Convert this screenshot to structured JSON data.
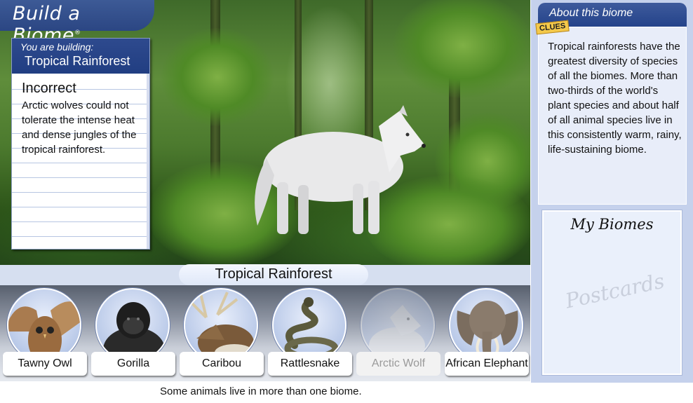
{
  "app": {
    "title": "Build a Biome",
    "trademark": "®"
  },
  "building": {
    "subtitle": "You are building:",
    "biome": "Tropical Rainforest"
  },
  "result": {
    "title": "Incorrect",
    "text": "Arctic wolves could not tolerate the intense heat and dense jungles of the tropical rainforest."
  },
  "biome_label": "Tropical Rainforest",
  "animals": [
    {
      "label": "Tawny Owl",
      "icon": "owl-icon",
      "state": "available"
    },
    {
      "label": "Gorilla",
      "icon": "gorilla-icon",
      "state": "available"
    },
    {
      "label": "Caribou",
      "icon": "caribou-icon",
      "state": "available"
    },
    {
      "label": "Rattlesnake",
      "icon": "rattlesnake-icon",
      "state": "available"
    },
    {
      "label": "Arctic Wolf",
      "icon": "wolf-icon",
      "state": "disabled"
    },
    {
      "label": "African Elephant",
      "icon": "elephant-icon",
      "state": "available"
    }
  ],
  "footer_note": "Some animals live in more than one biome.",
  "about": {
    "title": "About this biome",
    "clues_badge": "CLUES",
    "text": "Tropical rainforests have the greatest diversity of species of all the biomes. More than two-thirds of the world's plant species and about half of all animal species live in this consistently warm, rainy, life-sustaining biome."
  },
  "my_biomes": {
    "title": "My Biomes",
    "postcards_label": "Postcards"
  },
  "colors": {
    "header_blue": "#2b4683",
    "panel_bg": "#c5d1ec",
    "clues_yellow": "#f4c94a"
  }
}
